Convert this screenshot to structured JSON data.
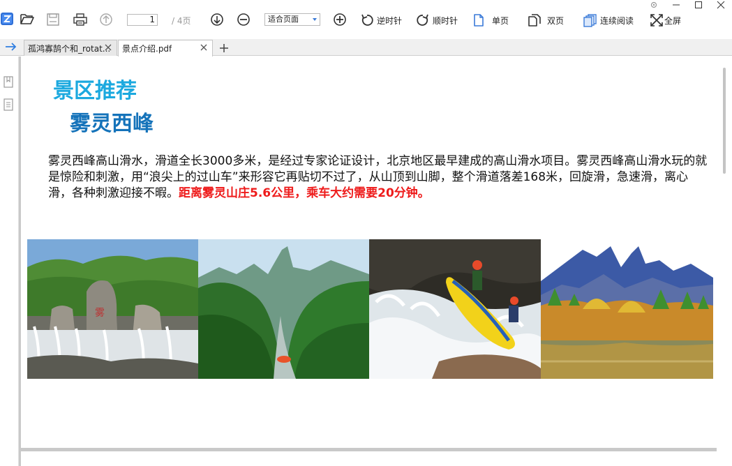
{
  "toolbar": {
    "page_current": "1",
    "page_total": "/ 4页",
    "zoom_mode": "适合页面",
    "rotate_ccw_label": "逆时针",
    "rotate_cw_label": "顺时针",
    "single_page_label": "单页",
    "double_page_label": "双页",
    "continuous_label": "连续阅读",
    "fullscreen_label": "全屏",
    "accent_color": "#3a7ad8"
  },
  "tabs": [
    {
      "label": "孤鸿寡鹄个和_rotat..."
    },
    {
      "label": "景点介绍.pdf"
    }
  ],
  "document": {
    "heading": "景区推荐",
    "subheading": "雾灵西峰",
    "paragraph_intro": "雾灵西峰高山滑水，滑道全长3000多米，是经过专家论证设计，北京地区最早建成的高山滑水项目。雾灵西峰高山滑水玩的就是惊险和刺激，用“浪尖上的过山车”来形容它再贴切不过了，从山顶到山脚，整个滑道落差168米，回旋滑，急速滑，离心滑，各种刺激迎接不暇。",
    "paragraph_highlight": "距离雾灵山庄5.6公里，乘车大约需要20分钟。",
    "heading_color": "#1ca9df",
    "subheading_color": "#1573ba",
    "highlight_color": "#ee1b1b"
  },
  "icons": {
    "app_logo": "app-logo-icon",
    "open": "open-folder-icon",
    "save": "save-icon",
    "print": "print-icon",
    "prev_page": "arrow-up-circle-icon",
    "next_page": "arrow-down-circle-icon",
    "zoom_out": "zoom-out-icon",
    "zoom_in": "zoom-in-icon",
    "settings": "gear-icon",
    "bookmark": "bookmark-icon",
    "thumbnails": "page-list-icon"
  }
}
